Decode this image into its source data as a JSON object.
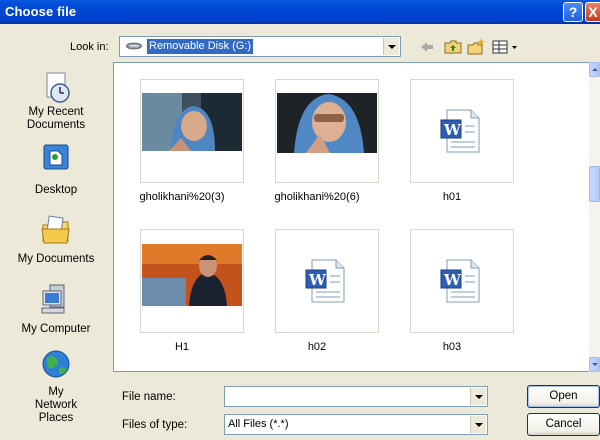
{
  "window": {
    "title": "Choose file",
    "help_label": "?",
    "close_label": "X"
  },
  "look_in": {
    "label": "Look in:",
    "value": "Removable Disk (G:)"
  },
  "places": [
    {
      "label": "My Recent Documents",
      "icon": "recent-documents-icon"
    },
    {
      "label": "Desktop",
      "icon": "desktop-icon"
    },
    {
      "label": "My Documents",
      "icon": "my-documents-icon"
    },
    {
      "label": "My Computer",
      "icon": "my-computer-icon"
    },
    {
      "label": "My Network Places",
      "icon": "network-places-icon"
    }
  ],
  "files": [
    {
      "name": "gholikhani%20(3)",
      "type": "image"
    },
    {
      "name": "gholikhani%20(6)",
      "type": "image"
    },
    {
      "name": "h01",
      "type": "word-document"
    },
    {
      "name": "H1",
      "type": "image"
    },
    {
      "name": "h02",
      "type": "word-document"
    },
    {
      "name": "h03",
      "type": "word-document"
    }
  ],
  "file_name": {
    "label": "File name:",
    "value": ""
  },
  "file_type": {
    "label": "Files of type:",
    "value": "All Files (*.*)"
  },
  "buttons": {
    "open": "Open",
    "cancel": "Cancel"
  },
  "colors": {
    "titlebar": "#0046d5",
    "selection": "#316ac5",
    "dialog_bg": "#ece9d8"
  }
}
